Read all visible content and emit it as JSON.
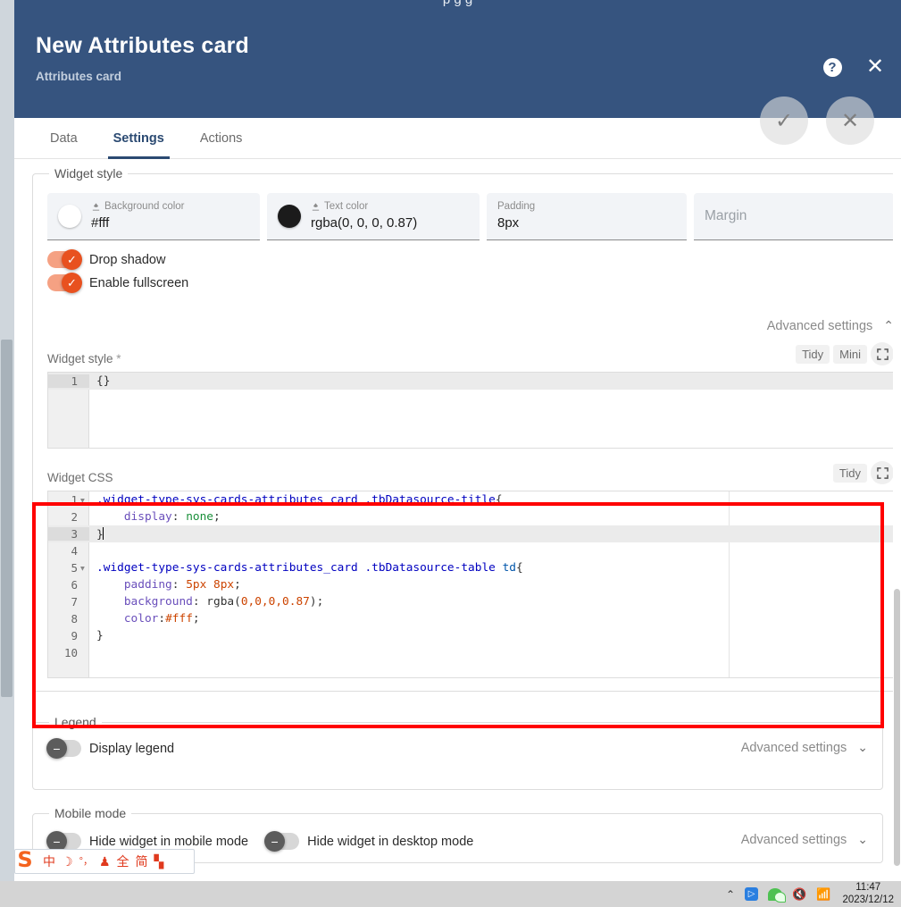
{
  "top_clip": {
    "text": "p          g          g"
  },
  "dialog": {
    "title": "New Attributes card",
    "subtitle": "Attributes card",
    "header_color": "#36547f",
    "help_label": "?",
    "close_label": "✕",
    "fab_confirm": "✓",
    "fab_cancel": "✕"
  },
  "tabs": [
    {
      "label": "Data",
      "active": false
    },
    {
      "label": "Settings",
      "active": true
    },
    {
      "label": "Actions",
      "active": false
    }
  ],
  "widget_style_section": {
    "legend": "Widget style",
    "fields": [
      {
        "label": "Background color",
        "value": "#fff",
        "swatch": "#ffffff",
        "icon": "eyedropper-icon"
      },
      {
        "label": "Text color",
        "value": "rgba(0, 0, 0, 0.87)",
        "swatch": "#1b1b1b",
        "icon": "eyedropper-icon"
      },
      {
        "label": "Padding",
        "value": "8px"
      },
      {
        "label": "Margin",
        "placeholder": "Margin",
        "value": ""
      }
    ],
    "toggles": [
      {
        "label": "Drop shadow",
        "state": "on"
      },
      {
        "label": "Enable fullscreen",
        "state": "on"
      }
    ],
    "advanced_label": "Advanced settings",
    "advanced_chevron": "⌃",
    "widget_style_editor": {
      "label": "Widget style",
      "required_mark": "*",
      "tools": [
        "Tidy",
        "Mini"
      ],
      "fullscreen_icon": "fullscreen-icon",
      "lines": [
        {
          "n": "1",
          "text": "{}"
        }
      ]
    },
    "widget_css_editor": {
      "label": "Widget CSS",
      "tools": [
        "Tidy"
      ],
      "fullscreen_icon": "fullscreen-icon",
      "lines": [
        {
          "n": "1",
          "fold": true,
          "text": ".widget-type-sys-cards-attributes_card .tbDatasource-title{"
        },
        {
          "n": "2",
          "fold": false,
          "text": "    display: none;"
        },
        {
          "n": "3",
          "fold": false,
          "text": "}",
          "active": true,
          "caret": true
        },
        {
          "n": "4",
          "fold": false,
          "text": ""
        },
        {
          "n": "5",
          "fold": true,
          "text": ".widget-type-sys-cards-attributes_card .tbDatasource-table td{"
        },
        {
          "n": "6",
          "fold": false,
          "text": "    padding: 5px 8px;"
        },
        {
          "n": "7",
          "fold": false,
          "text": "    background: rgba(0,0,0,0.87);"
        },
        {
          "n": "8",
          "fold": false,
          "text": "    color:#fff;"
        },
        {
          "n": "9",
          "fold": false,
          "text": "}"
        },
        {
          "n": "10",
          "fold": false,
          "text": ""
        }
      ]
    }
  },
  "legend_section": {
    "legend": "Legend",
    "toggle": {
      "label": "Display legend",
      "state": "off"
    },
    "advanced_label": "Advanced settings",
    "advanced_chevron": "⌄"
  },
  "mobile_section": {
    "legend": "Mobile mode",
    "toggles": [
      {
        "label": "Hide widget in mobile mode",
        "state": "off"
      },
      {
        "label": "Hide widget in desktop mode",
        "state": "off"
      }
    ],
    "advanced_label": "Advanced settings",
    "advanced_chevron": "⌄"
  },
  "annotation": {
    "color": "#ff0000",
    "shape": "rectangle"
  },
  "ime_toolbar": {
    "logo": "S",
    "items": [
      {
        "glyph": "中",
        "name": "chinese-mode-icon"
      },
      {
        "glyph": "☽",
        "name": "moon-icon"
      },
      {
        "glyph": "°，",
        "name": "punctuation-icon"
      },
      {
        "glyph": "♟",
        "name": "user-icon"
      },
      {
        "glyph": "全",
        "name": "full-width-icon"
      },
      {
        "glyph": "简",
        "name": "simplified-icon"
      },
      {
        "glyph": "▚",
        "name": "toolbox-icon"
      }
    ]
  },
  "taskbar": {
    "chevron": "⌃",
    "icons": [
      "tray-expand-icon",
      "app-blue-icon",
      "wechat-icon",
      "speaker-muted-icon",
      "wifi-icon"
    ],
    "time": "11:47",
    "date": "2023/12/12"
  }
}
